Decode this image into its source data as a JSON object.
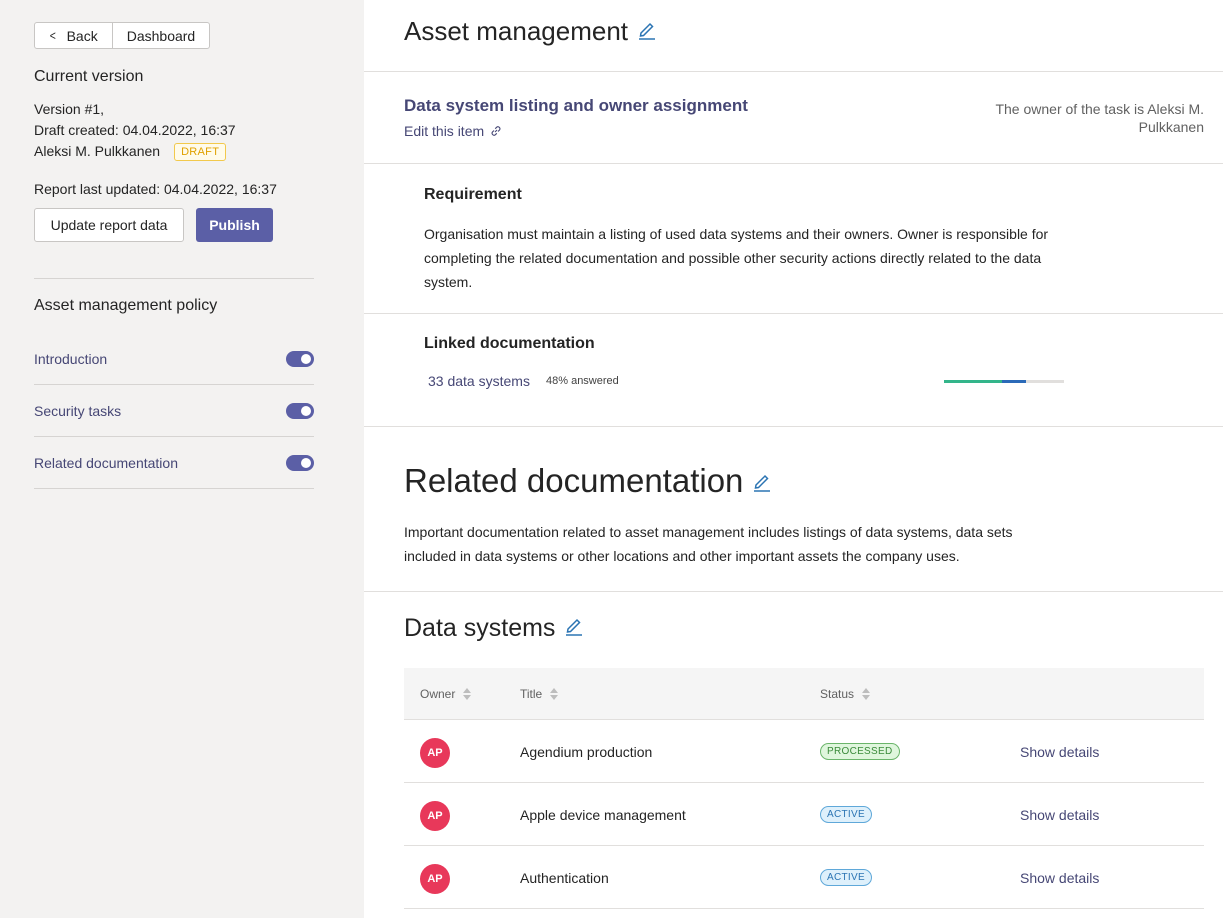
{
  "nav": {
    "back_label": "Back",
    "dashboard_label": "Dashboard"
  },
  "version": {
    "title": "Current version",
    "number": "Version #1,",
    "draft_created": "Draft created: 04.04.2022, 16:37",
    "author": "Aleksi M. Pulkkanen",
    "badge": "DRAFT",
    "report_updated": "Report last updated: 04.04.2022, 16:37",
    "update_label": "Update report data",
    "publish_label": "Publish"
  },
  "policy": {
    "title": "Asset management policy",
    "items": [
      {
        "label": "Introduction",
        "enabled": true
      },
      {
        "label": "Security tasks",
        "enabled": true
      },
      {
        "label": "Related documentation",
        "enabled": true
      }
    ]
  },
  "page": {
    "title": "Asset management"
  },
  "task": {
    "title": "Data system listing and owner assignment",
    "edit_label": "Edit this item",
    "owner_note": "The owner of the task is Aleksi M. Pulkkanen"
  },
  "requirement": {
    "title": "Requirement",
    "text": "Organisation must maintain a listing of used data systems and their owners. Owner is responsible for completing the related documentation and possible other security actions directly related to the data system."
  },
  "linked": {
    "title": "Linked documentation",
    "link_label": "33 data systems",
    "answered": "48% answered",
    "progress_green": 0.48,
    "progress_blue": 0.2
  },
  "related": {
    "title": "Related documentation",
    "text": "Important documentation related to asset management includes listings of data systems, data sets included in data systems or other locations and other important assets the company uses."
  },
  "data_systems": {
    "title": "Data systems",
    "columns": {
      "owner": "Owner",
      "title": "Title",
      "status": "Status"
    },
    "rows": [
      {
        "initials": "AP",
        "title": "Agendium production",
        "status": "PROCESSED",
        "action": "Show details"
      },
      {
        "initials": "AP",
        "title": "Apple device management",
        "status": "ACTIVE",
        "action": "Show details"
      },
      {
        "initials": "AP",
        "title": "Authentication",
        "status": "ACTIVE",
        "action": "Show details"
      }
    ]
  },
  "colors": {
    "accent": "#5b5fa6",
    "link": "#464775",
    "avatar": "#e8385a",
    "draft": "#e0a100"
  }
}
